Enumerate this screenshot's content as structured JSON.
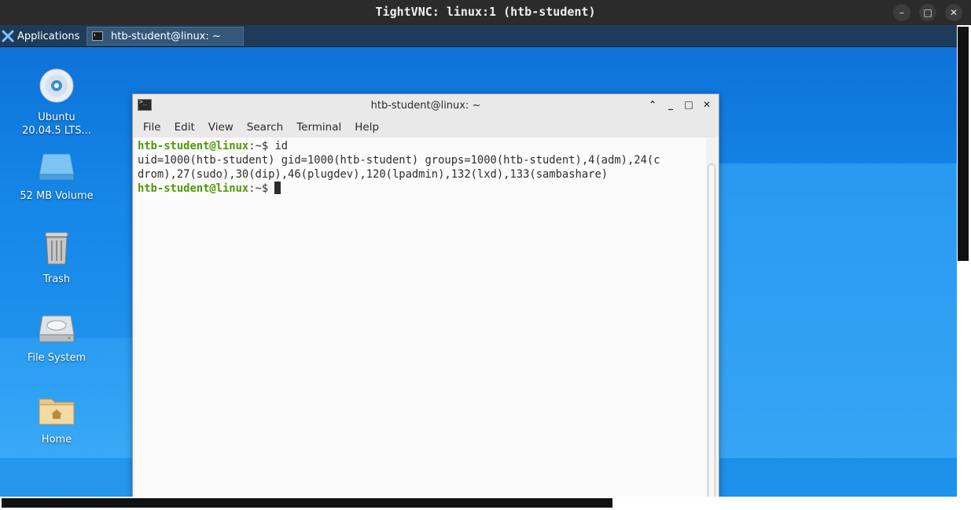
{
  "vnc": {
    "title": "TightVNC: linux:1 (htb-student)",
    "minimize_label": "–",
    "maximize_label": "□",
    "close_label": "✕"
  },
  "panel": {
    "applications_label": "Applications",
    "task_label": "htb-student@linux: ~"
  },
  "desktop_icons": [
    {
      "label": "Ubuntu 20.04.5 LTS...",
      "icon": "disc-icon"
    },
    {
      "label": "52 MB Volume",
      "icon": "drive-icon"
    },
    {
      "label": "Trash",
      "icon": "trash-icon"
    },
    {
      "label": "File System",
      "icon": "harddisk-icon"
    },
    {
      "label": "Home",
      "icon": "home-folder-icon"
    }
  ],
  "terminal": {
    "title": "htb-student@linux: ~",
    "menu": [
      "File",
      "Edit",
      "View",
      "Search",
      "Terminal",
      "Help"
    ],
    "prompt_user": "htb-student@linux",
    "prompt_suffix": ":~$ ",
    "command": "id",
    "output_line1": "uid=1000(htb-student) gid=1000(htb-student) groups=1000(htb-student),4(adm),24(c",
    "output_line2": "drom),27(sudo),30(dip),46(plugdev),120(lpadmin),132(lxd),133(sambashare)"
  },
  "colors": {
    "prompt": "#4e9a06",
    "panel": "#1e3c5a",
    "desktop": "#1588e8"
  }
}
